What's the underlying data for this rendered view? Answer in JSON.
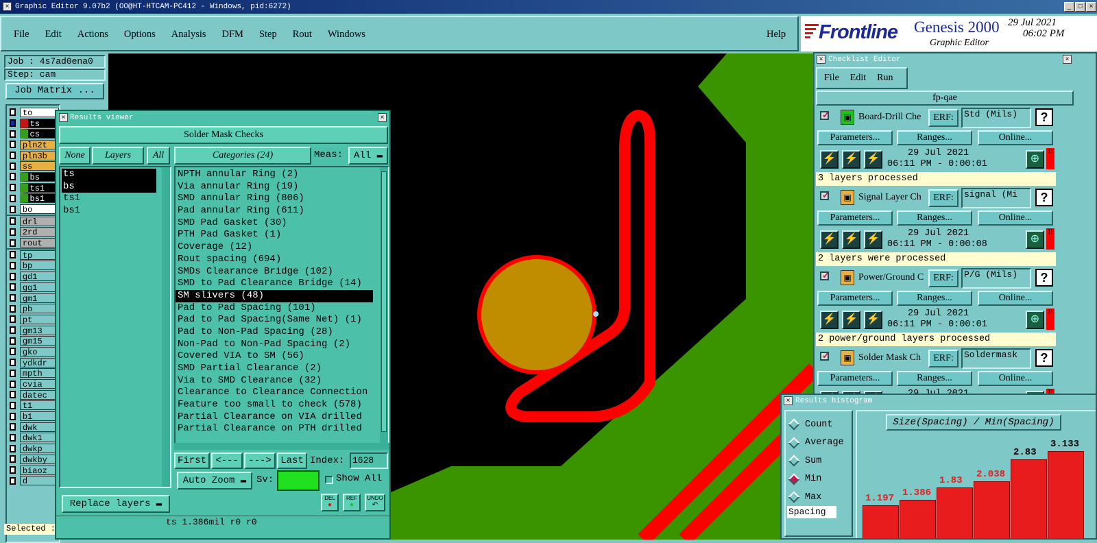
{
  "app": {
    "title": "Graphic Editor 9.07b2 (OO@HT-HTCAM-PC412 - Windows, pid:6272)"
  },
  "menu": [
    "File",
    "Edit",
    "Actions",
    "Options",
    "Analysis",
    "DFM",
    "Step",
    "Rout",
    "Windows"
  ],
  "help": "Help",
  "brand": {
    "logo": "Frontline",
    "product": "Genesis 2000",
    "subtitle": "Graphic Editor",
    "date": "29 Jul 2021",
    "time": "06:02 PM"
  },
  "job": {
    "job_label": "Job : 4s7ad0ena0",
    "step_label": "Step: cam",
    "matrix_button": "Job Matrix ..."
  },
  "layers": [
    {
      "name": "to",
      "color": "#ffffff"
    },
    {
      "name": "ts",
      "color": "#c01818"
    },
    {
      "name": "cs",
      "color": "#3a9c1c"
    },
    {
      "name": "pln2t",
      "color": "#e8b040"
    },
    {
      "name": "pln3b",
      "color": "#e8b040"
    },
    {
      "name": "ss",
      "color": "#e8b040"
    },
    {
      "name": "bs",
      "color": "#3a9c1c"
    },
    {
      "name": "ts1",
      "color": "#3a9c1c"
    },
    {
      "name": "bs1",
      "color": "#3a9c1c"
    },
    {
      "name": "bo",
      "color": "#ffffff"
    }
  ],
  "drill_layers": [
    "drl",
    "2rd",
    "rout"
  ],
  "doc_layers": [
    "tp",
    "bp",
    "gd1",
    "gg1",
    "gm1",
    "pb",
    "pt",
    "gm13",
    "gm15",
    "gko",
    "ydkdr",
    "mpth",
    "cvia",
    "datec",
    "t1",
    "b1",
    "dwk",
    "dwk1",
    "dwkp",
    "dwkby",
    "biaoz",
    "d"
  ],
  "selected_label": "Selected :",
  "results_viewer": {
    "title": "Results viewer",
    "header": "Solder Mask Checks",
    "none": "None",
    "layers": "Layers",
    "all": "All",
    "categories_btn": "Categories (24)",
    "meas": "Meas:",
    "meas_value": "All",
    "layer_list": [
      {
        "name": "ts",
        "selected": true
      },
      {
        "name": "bs",
        "selected": true
      },
      {
        "name": "ts1",
        "selected": false
      },
      {
        "name": "bs1",
        "selected": false
      }
    ],
    "categories": [
      "NPTH annular Ring (2)",
      "Via annular Ring (19)",
      "SMD annular Ring (806)",
      "Pad annular Ring (611)",
      "SMD Pad Gasket (30)",
      "PTH Pad Gasket (1)",
      "Coverage (12)",
      "Rout spacing (694)",
      "SMDs Clearance Bridge (102)",
      "SMD to Pad Clearance Bridge (14)",
      "SM slivers (48)",
      "Pad to Pad Spacing (101)",
      "Pad to Pad Spacing(Same Net) (1)",
      "Pad to Non-Pad Spacing (28)",
      "Non-Pad to Non-Pad Spacing (2)",
      "Covered VIA to SM (56)",
      "SMD Partial Clearance (2)",
      "Via to SMD Clearance (32)",
      "Clearance to Clearance Connection",
      "Feature too small to check (578)",
      "Partial Clearance on VIA drilled",
      "Partial Clearance on PTH drilled"
    ],
    "selected_category": "SM slivers (48)",
    "first": "First",
    "prev": "<---",
    "next": "--->",
    "last": "Last",
    "index_label": "Index:",
    "index_value": "1628",
    "auto_zoom": "Auto Zoom",
    "sv": "Sv:",
    "show_all": "Show All",
    "replace_layers": "Replace layers",
    "del": "DEL",
    "ref": "REF",
    "undo": "UNDO",
    "status": "ts 1.386mil  r0  r0"
  },
  "checklist": {
    "title": "Checklist Editor",
    "menu": [
      "File",
      "Edit",
      "Run"
    ],
    "name": "fp-qae",
    "erf": "ERF:",
    "params": "Parameters...",
    "ranges": "Ranges...",
    "online": "Online...",
    "items": [
      {
        "name": "Board-Drill Che",
        "erf": "Std (Mils)",
        "date": "29 Jul 2021",
        "time": "06:11 PM - 0:00:01",
        "status": "3 layers processed"
      },
      {
        "name": "Signal Layer Ch",
        "erf": "signal (Mi",
        "date": "29 Jul 2021",
        "time": "06:11 PM - 0:00:08",
        "status": "2 layers were processed"
      },
      {
        "name": "Power/Ground C",
        "erf": "P/G (Mils)",
        "date": "29 Jul 2021",
        "time": "06:11 PM - 0:00:01",
        "status": "2 power/ground layers processed"
      },
      {
        "name": "Solder Mask Ch",
        "erf": "Soldermask",
        "date": "29 Jul 2021",
        "time": "",
        "status": ""
      }
    ]
  },
  "histogram": {
    "title": "Results histogram",
    "options": [
      "Count",
      "Average",
      "Sum",
      "Min",
      "Max"
    ],
    "selected": "Min",
    "spacing": "Spacing",
    "heading": "Size(Spacing) / Min(Spacing)",
    "bars": [
      1.197,
      1.386,
      1.83,
      2.038,
      2.83,
      3.133
    ],
    "bar_labels": [
      "1.197",
      "1.386",
      "1.83",
      "2.038",
      "2.83",
      "3.133"
    ]
  }
}
